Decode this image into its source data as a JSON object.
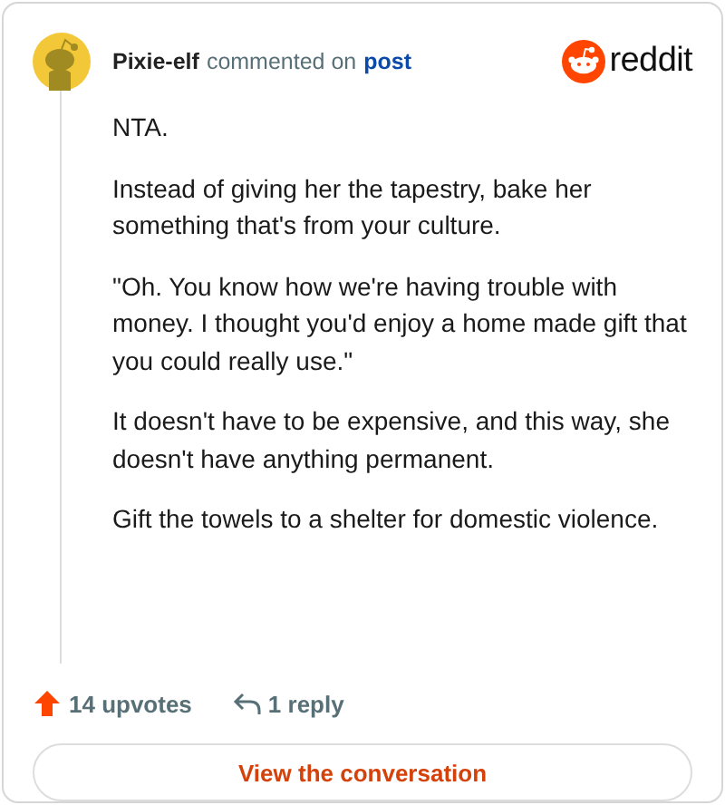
{
  "header": {
    "username": "Pixie-elf",
    "action": "commented on",
    "link": "post",
    "brand": "reddit"
  },
  "comment": {
    "paragraphs": [
      "NTA.",
      "Instead of giving her the tapestry, bake her something that's from your culture.",
      "\"Oh. You know how we're having trouble with money. I thought you'd enjoy a home made gift that you could really use.\"",
      "It doesn't have to be expensive, and this way, she doesn't have anything permanent.",
      "Gift the towels to a shelter for domestic violence."
    ]
  },
  "footer": {
    "upvotes": "14 upvotes",
    "replies": "1 reply",
    "button": "View the conversation"
  }
}
